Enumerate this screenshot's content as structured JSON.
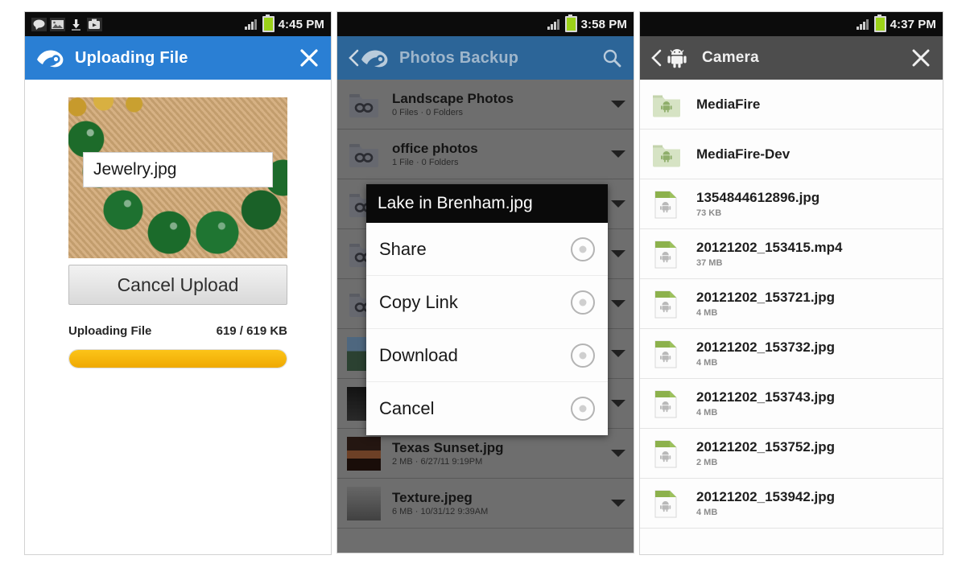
{
  "panel1": {
    "status": {
      "time": "4:45 PM",
      "icons": [
        "message-icon",
        "gallery-icon",
        "download-icon",
        "media-icon"
      ],
      "signal": "signal-icon",
      "battery": "battery-icon"
    },
    "appbar": {
      "logo": "mediafire-logo-icon",
      "title": "Uploading File",
      "close": "close-icon"
    },
    "thumbnail_alt": "green bead necklace on burlap",
    "filename_value": "Jewelry.jpg",
    "cancel_label": "Cancel Upload",
    "progress_label": "Uploading File",
    "progress_value": "619 / 619 KB",
    "progress_percent": 100,
    "accent_color": "#2a7fd4",
    "progress_color": "#f5b50a"
  },
  "panel2": {
    "status": {
      "time": "3:58 PM",
      "signal": "signal-icon",
      "battery": "battery-icon"
    },
    "appbar": {
      "back": "back-chevron-icon",
      "logo": "mediafire-logo-icon",
      "title": "Photos Backup",
      "search": "search-icon"
    },
    "rows": [
      {
        "name": "Landscape Photos",
        "sub": "0 Files · 0 Folders",
        "thumb": "folder"
      },
      {
        "name": "office photos",
        "sub": "1 File · 0 Folders",
        "thumb": "folder"
      },
      {
        "name": "",
        "sub": "",
        "thumb": "folder"
      },
      {
        "name": "",
        "sub": "",
        "thumb": "folder"
      },
      {
        "name": "",
        "sub": "",
        "thumb": "folder"
      },
      {
        "name": "",
        "sub": "",
        "thumb": "photo-lake"
      },
      {
        "name": "",
        "sub": "",
        "thumb": "photo-dark"
      },
      {
        "name": "Texas Sunset.jpg",
        "sub": "2 MB · 6/27/11 9:19PM",
        "thumb": "photo-sunset"
      },
      {
        "name": "Texture.jpeg",
        "sub": "6 MB · 10/31/12 9:39AM",
        "thumb": "photo-texture"
      }
    ],
    "dialog": {
      "title": "Lake in Brenham.jpg",
      "items": [
        {
          "label": "Share",
          "icon": "radio-icon"
        },
        {
          "label": "Copy Link",
          "icon": "radio-icon"
        },
        {
          "label": "Download",
          "icon": "radio-icon"
        },
        {
          "label": "Cancel",
          "icon": "radio-icon"
        }
      ]
    }
  },
  "panel3": {
    "status": {
      "time": "4:37 PM",
      "signal": "signal-icon",
      "battery": "battery-icon"
    },
    "appbar": {
      "back": "back-chevron-icon",
      "logo": "android-robot-icon",
      "title": "Camera",
      "close": "close-icon"
    },
    "rows": [
      {
        "name": "MediaFire",
        "sub": "",
        "type": "folder"
      },
      {
        "name": "MediaFire-Dev",
        "sub": "",
        "type": "folder"
      },
      {
        "name": "1354844612896.jpg",
        "sub": "73 KB",
        "type": "file"
      },
      {
        "name": "20121202_153415.mp4",
        "sub": "37 MB",
        "type": "file"
      },
      {
        "name": "20121202_153721.jpg",
        "sub": "4 MB",
        "type": "file"
      },
      {
        "name": "20121202_153732.jpg",
        "sub": "4 MB",
        "type": "file"
      },
      {
        "name": "20121202_153743.jpg",
        "sub": "4 MB",
        "type": "file"
      },
      {
        "name": "20121202_153752.jpg",
        "sub": "2 MB",
        "type": "file"
      },
      {
        "name": "20121202_153942.jpg",
        "sub": "4 MB",
        "type": "file"
      }
    ]
  }
}
